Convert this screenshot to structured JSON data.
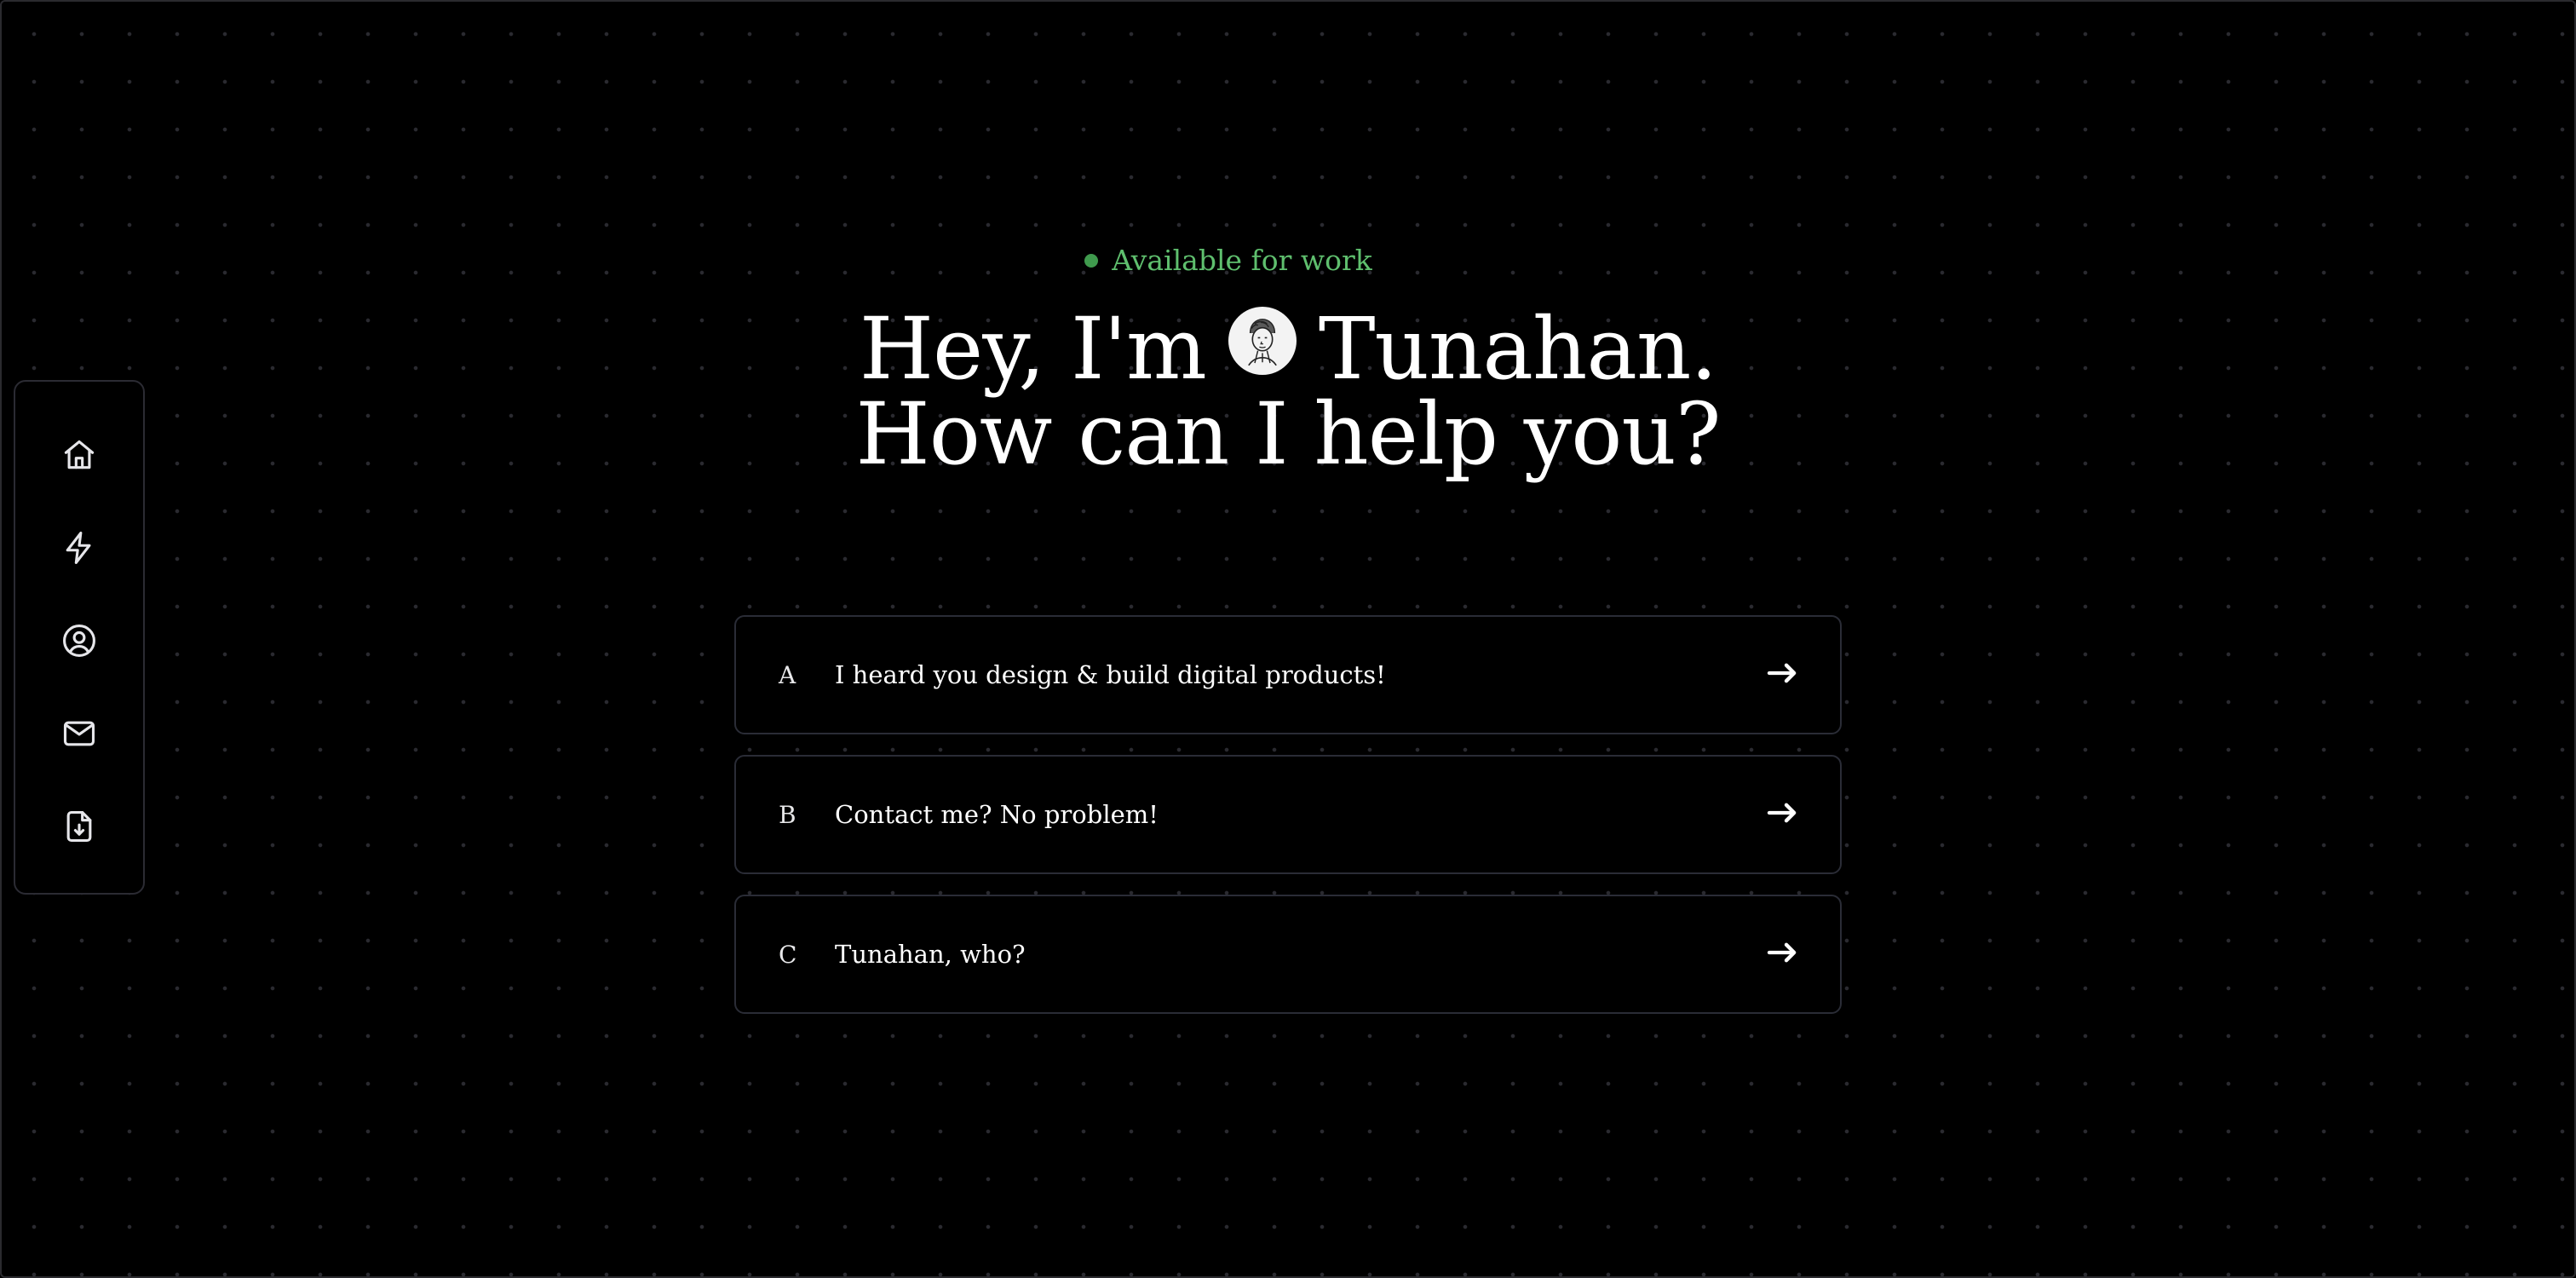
{
  "status": {
    "text": "Available for work",
    "dot_color": "#3f9a4d",
    "text_color": "#5fbf6e"
  },
  "hero": {
    "line1_before": "Hey, I'm",
    "line1_after": "Tunahan.",
    "line2": "How can I help you?"
  },
  "sidebar": {
    "items": [
      {
        "name": "home",
        "icon": "home-icon"
      },
      {
        "name": "lightning",
        "icon": "lightning-icon"
      },
      {
        "name": "profile",
        "icon": "user-circle-icon"
      },
      {
        "name": "mail",
        "icon": "mail-icon"
      },
      {
        "name": "resume-download",
        "icon": "file-download-icon"
      }
    ]
  },
  "options": [
    {
      "letter": "A",
      "text": "I heard you design & build digital products!",
      "icon": "arrow-right-icon"
    },
    {
      "letter": "B",
      "text": "Contact me? No problem!",
      "icon": "arrow-right-icon"
    },
    {
      "letter": "C",
      "text": "Tunahan, who?",
      "icon": "arrow-right-icon"
    }
  ],
  "colors": {
    "background": "#000000",
    "border": "#2a2c36",
    "text": "#ffffff"
  }
}
